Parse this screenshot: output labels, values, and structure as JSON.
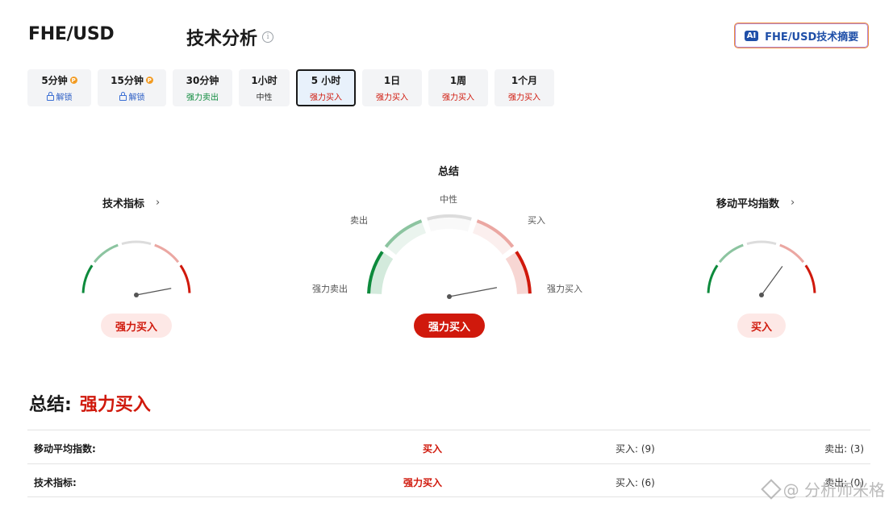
{
  "header": {
    "pair": "FHE/USD",
    "heading": "技术分析",
    "info_glyph": "i"
  },
  "ai_button": {
    "badge": "AI",
    "label": "FHE/USD技术摘要"
  },
  "tabs": [
    {
      "label": "5分钟",
      "sub": "解锁",
      "pro": "P",
      "locked": true
    },
    {
      "label": "15分钟",
      "sub": "解锁",
      "pro": "P",
      "locked": true
    },
    {
      "label": "30分钟",
      "sub": "强力卖出"
    },
    {
      "label": "1小时",
      "sub": "中性"
    },
    {
      "label": "5 小时",
      "sub": "强力买入",
      "active": true
    },
    {
      "label": "1日",
      "sub": "强力买入"
    },
    {
      "label": "1周",
      "sub": "强力买入"
    },
    {
      "label": "1个月",
      "sub": "强力买入"
    }
  ],
  "gauges": {
    "technical": {
      "title": "技术指标",
      "chevron": "›",
      "result": "强力买入",
      "needle": 0.94
    },
    "summary": {
      "title": "总结",
      "result": "强力买入",
      "needle": 0.94,
      "labels": {
        "strong_sell": "强力卖出",
        "sell": "卖出",
        "neutral": "中性",
        "buy": "买入",
        "strong_buy": "强力买入"
      }
    },
    "moving_avg": {
      "title": "移动平均指数",
      "chevron": "›",
      "result": "买入",
      "needle": 0.7
    }
  },
  "summary": {
    "label": "总结:",
    "value": "强力买入"
  },
  "table": [
    {
      "name": "移动平均指数:",
      "signal": "买入",
      "buy": "买入: (9)",
      "sell": "卖出: (3)"
    },
    {
      "name": "技术指标:",
      "signal": "强力买入",
      "buy": "买入: (6)",
      "sell": "卖出: (0)"
    }
  ],
  "watermark": {
    "text": "@ 分析师米格"
  },
  "colors": {
    "strong_sell": "#0d8a3c",
    "sell": "#8cc4a0",
    "neutral": "#dcdcdc",
    "buy": "#eba7a2",
    "strong_buy": "#d0190c"
  }
}
